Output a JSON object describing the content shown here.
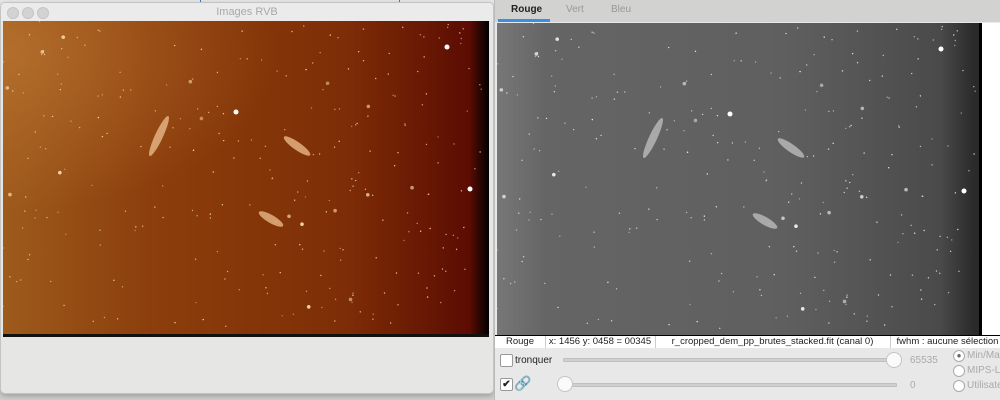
{
  "left_window": {
    "title": "Images RVB"
  },
  "right_window": {
    "tabs": [
      {
        "label": "Rouge",
        "active": true
      },
      {
        "label": "Vert"
      },
      {
        "label": "Bleu"
      }
    ],
    "status_bar": {
      "channel": "Rouge",
      "coords": "x: 1456 y: 0458 = 00345",
      "filename": "r_cropped_dem_pp_brutes_stacked.fit (canal 0)",
      "fwhm": "fwhm : aucune sélection"
    },
    "controls": {
      "clip_label": "tronquer",
      "clip_checked": false,
      "link_checked": true,
      "high_value": "65535",
      "low_value": "0",
      "high_slider_fraction": 1.0,
      "low_slider_fraction": 0.0,
      "scale_options": [
        {
          "label": "Min/Max",
          "selected": true
        },
        {
          "label": "MIPS-LO",
          "selected": false
        },
        {
          "label": "Utilisateur",
          "selected": false
        }
      ]
    }
  }
}
